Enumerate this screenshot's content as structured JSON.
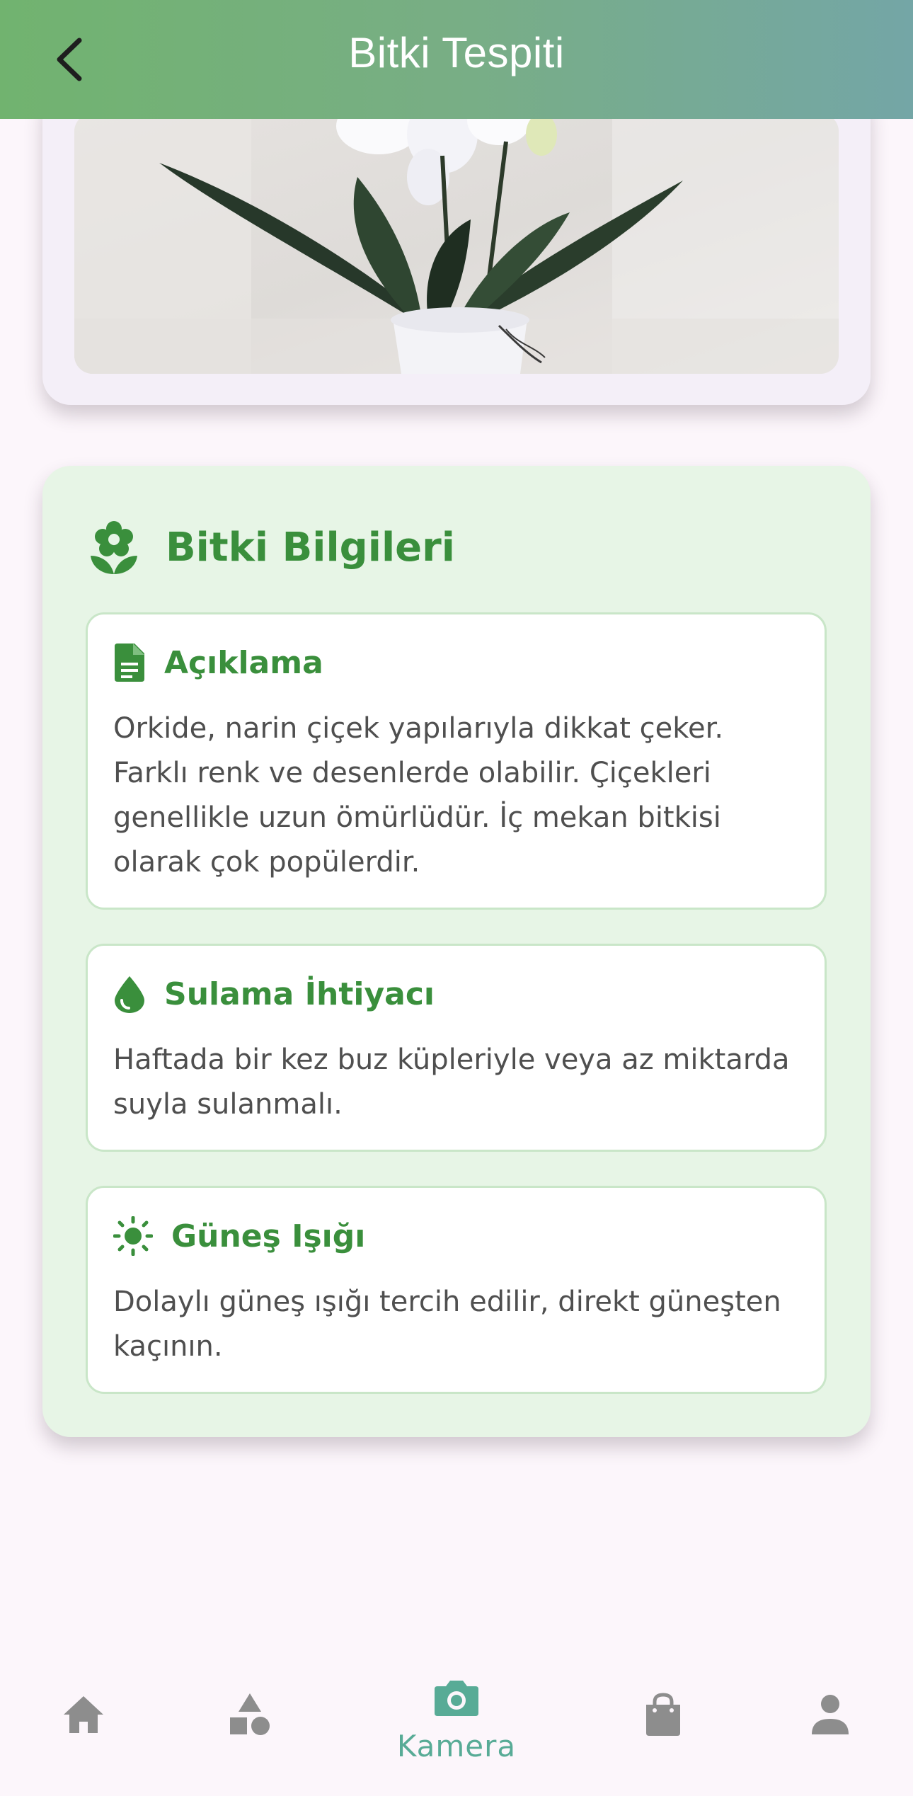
{
  "appbar": {
    "title": "Bitki Tespiti",
    "back_icon": "arrow-back-icon"
  },
  "photo": {
    "subject": "orchid-plant-image"
  },
  "info": {
    "title": "Bitki Bilgileri",
    "icon": "flower-icon",
    "sections": [
      {
        "icon": "document-icon",
        "title": "Açıklama",
        "body": "Orkide, narin çiçek yapılarıyla dikkat çeker. Farklı renk ve desenlerde olabilir. Çiçekleri genellikle uzun ömürlüdür. İç mekan bitkisi olarak çok popülerdir."
      },
      {
        "icon": "water-drop-icon",
        "title": "Sulama İhtiyacı",
        "body": "Haftada bir kez buz küpleriyle veya az miktarda suyla sulanmalı."
      },
      {
        "icon": "sun-icon",
        "title": "Güneş Işığı",
        "body": "Dolaylı güneş ışığı tercih edilir, direkt güneşten kaçının."
      }
    ]
  },
  "nav": {
    "items": [
      {
        "icon": "home-icon",
        "label": ""
      },
      {
        "icon": "category-icon",
        "label": ""
      },
      {
        "icon": "camera-icon",
        "label": "Kamera",
        "active": true
      },
      {
        "icon": "shopping-bag-icon",
        "label": ""
      },
      {
        "icon": "person-icon",
        "label": ""
      }
    ]
  },
  "colors": {
    "accent_green": "#3a8f3c",
    "nav_active": "#58ab96",
    "nav_inactive": "#8d8d8d",
    "info_card_bg": "#e7f5e6",
    "page_bg": "#fcf6fb"
  }
}
